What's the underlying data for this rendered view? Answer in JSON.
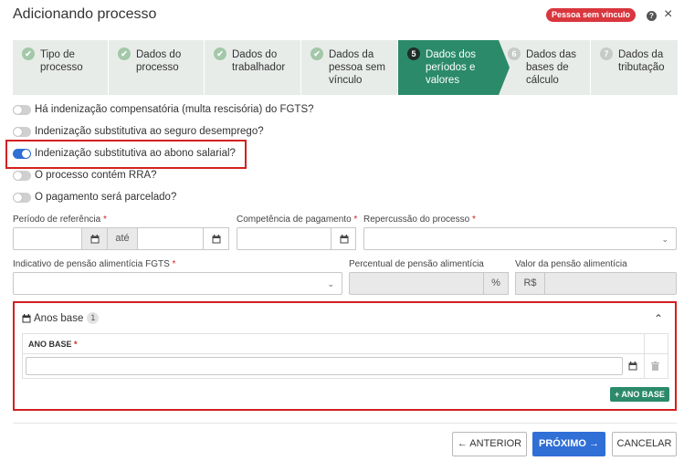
{
  "header": {
    "title": "Adicionando processo",
    "badge": "Pessoa sem vínculo",
    "help": "?",
    "close": "×"
  },
  "stepper": [
    {
      "num": "✔",
      "label": "Tipo de\nprocesso",
      "state": "done"
    },
    {
      "num": "✔",
      "label": "Dados do\nprocesso",
      "state": "done"
    },
    {
      "num": "✔",
      "label": "Dados do\ntrabalhador",
      "state": "done"
    },
    {
      "num": "✔",
      "label": "Dados da\npessoa sem\nvínculo",
      "state": "done"
    },
    {
      "num": "5",
      "label": "Dados dos\nperíodos e\nvalores",
      "state": "active"
    },
    {
      "num": "6",
      "label": "Dados das\nbases de\ncálculo",
      "state": "todo"
    },
    {
      "num": "7",
      "label": "Dados da\ntributação",
      "state": "todo"
    }
  ],
  "toggles": [
    {
      "label": "Há indenização compensatória (multa rescisória) do FGTS?",
      "on": false
    },
    {
      "label": "Indenização substitutiva ao seguro desemprego?",
      "on": false
    },
    {
      "label": "Indenização substitutiva ao abono salarial?",
      "on": true
    },
    {
      "label": "O processo contém RRA?",
      "on": false
    },
    {
      "label": "O pagamento será parcelado?",
      "on": false
    }
  ],
  "form": {
    "periodo_label": "Período de referência",
    "ate": "até",
    "competencia_label": "Competência de pagamento",
    "repercussao_label": "Repercussão do processo",
    "indicativo_label": "Indicativo de pensão alimentícia FGTS",
    "percentual_label": "Percentual de pensão alimentícia",
    "percent_addon": "%",
    "valor_label": "Valor da pensão alimentícia",
    "valor_addon": "R$",
    "required_mark": "*"
  },
  "anos_base": {
    "title": "Anos base",
    "count": "1",
    "column": "ANO BASE",
    "add_label": "+ ANO BASE"
  },
  "footer": {
    "anterior": "← ANTERIOR",
    "proximo": "PRÓXIMO →",
    "cancelar": "CANCELAR"
  },
  "colors": {
    "accent": "#2b8a6a",
    "primary": "#2f6fd6",
    "badge": "#d9363e",
    "highlight": "#d42020"
  }
}
